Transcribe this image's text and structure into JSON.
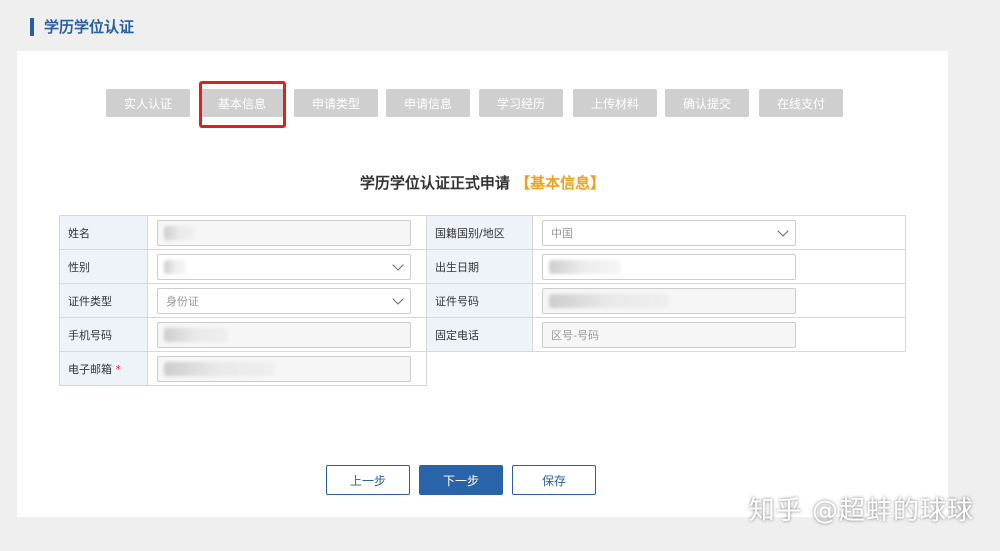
{
  "page_title": "学历学位认证",
  "steps": [
    "实人认证",
    "基本信息",
    "申请类型",
    "申请信息",
    "学习经历",
    "上传材料",
    "确认提交",
    "在线支付"
  ],
  "active_step": "基本信息",
  "form_title": "学历学位认证正式申请",
  "form_title_accent": "【基本信息】",
  "form": {
    "name_label": "姓名",
    "nationality_label": "国籍国别/地区",
    "nationality_value": "中国",
    "gender_label": "性别",
    "birthdate_label": "出生日期",
    "id_type_label": "证件类型",
    "id_type_value": "身份证",
    "id_number_label": "证件号码",
    "mobile_label": "手机号码",
    "landline_label": "固定电话",
    "landline_placeholder": "区号-号码",
    "email_label": "电子邮箱",
    "required_mark": "*"
  },
  "buttons": {
    "prev": "上一步",
    "next": "下一步",
    "save": "保存"
  },
  "watermark": "知乎 @超蚌的球球",
  "colors": {
    "accent_blue": "#2a5f9e",
    "highlight_red": "#e02020",
    "title_accent": "#f0a020",
    "step_bg": "#cfcfcf"
  }
}
